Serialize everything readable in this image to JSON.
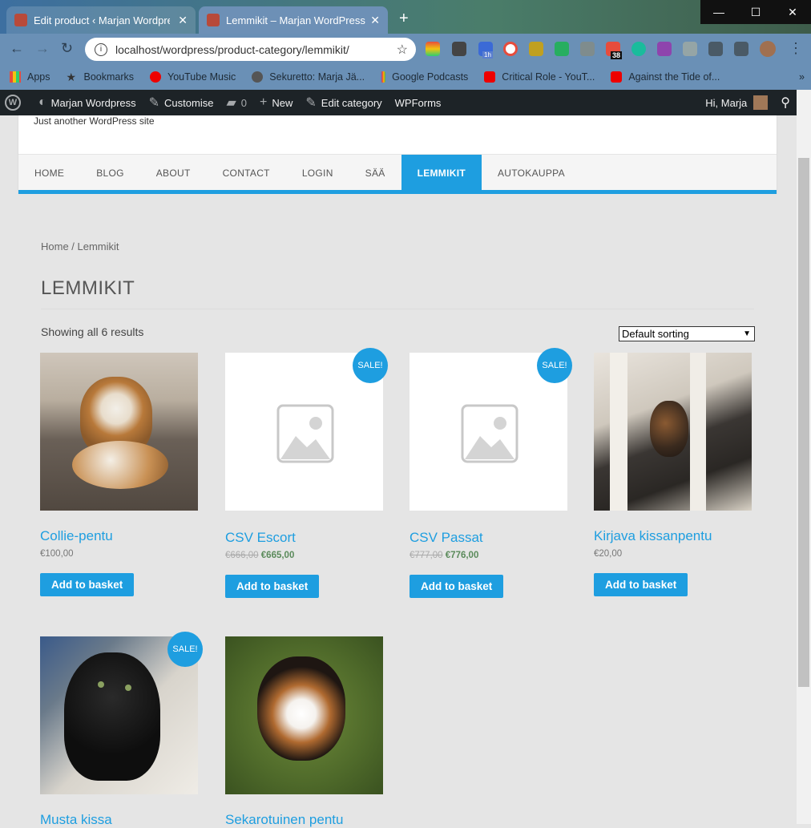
{
  "browser": {
    "tabs": [
      {
        "title": "Edit product ‹ Marjan Wordpress",
        "close": "✕"
      },
      {
        "title": "Lemmikit – Marjan WordPress",
        "close": "✕"
      }
    ],
    "new_tab": "+",
    "url": "localhost/wordpress/product-category/lemmikit/",
    "window_controls": [
      "—",
      "☐",
      "✕"
    ],
    "ext_badge": "38",
    "ext_badge2": "1h",
    "bookmarks": [
      {
        "label": "Apps",
        "icon": "apps-icon"
      },
      {
        "label": "Bookmarks",
        "icon": "star-icon"
      },
      {
        "label": "YouTube Music",
        "icon": "youtube-music-icon"
      },
      {
        "label": "Sekuretto: Marja Jä...",
        "icon": "globe-icon"
      },
      {
        "label": "Google Podcasts",
        "icon": "podcasts-icon"
      },
      {
        "label": "Critical Role - YouT...",
        "icon": "youtube-icon"
      },
      {
        "label": "Against the Tide of...",
        "icon": "youtube-icon"
      }
    ],
    "bookmarks_more": "»"
  },
  "adminbar": {
    "site": "Marjan Wordpress",
    "customise": "Customise",
    "comments": "0",
    "new": "New",
    "edit_category": "Edit category",
    "wpforms": "WPForms",
    "greeting": "Hi, Marja"
  },
  "site": {
    "tagline": "Just another WordPress site",
    "nav": [
      "HOME",
      "BLOG",
      "ABOUT",
      "CONTACT",
      "LOGIN",
      "SÄÄ",
      "LEMMIKIT",
      "AUTOKAUPPA"
    ]
  },
  "shop": {
    "breadcrumb": "Home / Lemmikit",
    "title": "LEMMIKIT",
    "result_count": "Showing all 6 results",
    "sorting": "Default sorting",
    "sale_badge": "SALE!",
    "add_to_basket": "Add to basket",
    "products": [
      {
        "name": "Collie-pentu",
        "price": "€100,00",
        "old_price": "",
        "sale": false,
        "image": "collie-puppy-photo"
      },
      {
        "name": "CSV Escort",
        "price": "€665,00",
        "old_price": "€666,00",
        "sale": true,
        "image": "placeholder"
      },
      {
        "name": "CSV Passat",
        "price": "€776,00",
        "old_price": "€777,00",
        "sale": true,
        "image": "placeholder"
      },
      {
        "name": "Kirjava kissanpentu",
        "price": "€20,00",
        "old_price": "",
        "sale": false,
        "image": "tortoiseshell-kitten-photo"
      },
      {
        "name": "Musta kissa",
        "price": "",
        "old_price": "",
        "sale": true,
        "image": "black-kitten-photo"
      },
      {
        "name": "Sekarotuinen pentu",
        "price": "",
        "old_price": "",
        "sale": false,
        "image": "mixed-breed-puppy-photo"
      }
    ]
  }
}
